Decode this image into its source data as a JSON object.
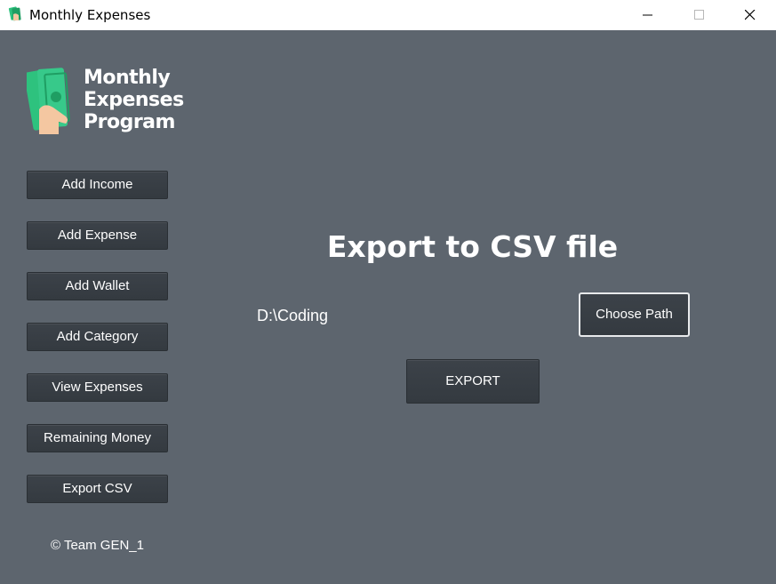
{
  "window": {
    "title": "Monthly Expenses",
    "icon": "money-hand-icon"
  },
  "logo": {
    "icon": "money-hand-icon",
    "lines": [
      "Monthly",
      "Expenses",
      "Program"
    ]
  },
  "sidebar": {
    "items": [
      {
        "label": "Add Income"
      },
      {
        "label": "Add Expense"
      },
      {
        "label": "Add Wallet"
      },
      {
        "label": "Add Category"
      },
      {
        "label": "View Expenses"
      },
      {
        "label": "Remaining Money"
      },
      {
        "label": "Export CSV"
      }
    ],
    "footer": "© Team GEN_1"
  },
  "main": {
    "heading": "Export to CSV file",
    "path_value": "D:\\Coding",
    "choose_path_label": "Choose Path",
    "export_label": "EXPORT"
  },
  "colors": {
    "background": "#5d656e",
    "button": "#3a4046",
    "brand_green": "#2ec27e",
    "text": "#ffffff"
  }
}
